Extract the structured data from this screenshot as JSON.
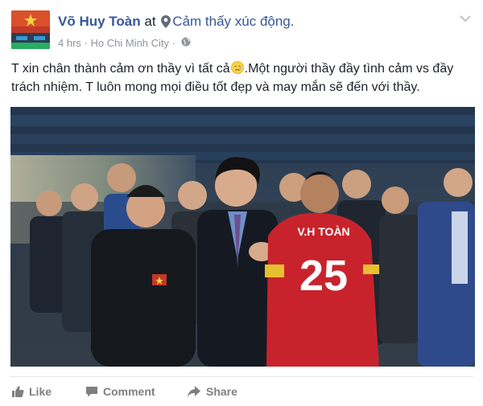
{
  "header": {
    "author": "Võ Huy Toàn",
    "at_word": "at",
    "feeling": "Cảm thấy xúc động.",
    "time": "4 hrs",
    "separator": "·",
    "location": "Ho Chi Minh City",
    "separator2": "·"
  },
  "post": {
    "text_before_emoji": "T xin chân thành cảm ơn thầy vì tất cả",
    "text_after_emoji": ".Một người thầy đầy tình cảm vs đầy trách nhiệm. T luôn mong mọi điều tốt đẹp và may mắn sẽ đến với thầy.",
    "photo": {
      "jersey_name": "V.H TOÀN",
      "jersey_number": "25"
    }
  },
  "actions": {
    "like": "Like",
    "comment": "Comment",
    "share": "Share"
  },
  "colors": {
    "link": "#365899",
    "meta": "#90949c",
    "action": "#7f7f7f"
  }
}
